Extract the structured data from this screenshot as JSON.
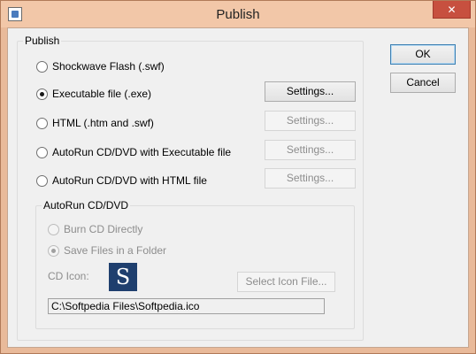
{
  "window": {
    "title": "Publish",
    "close_glyph": "✕",
    "icon": "app-window-icon"
  },
  "publish_group": {
    "legend": "Publish",
    "options": [
      {
        "label": "Shockwave Flash (.swf)",
        "checked": false
      },
      {
        "label": "Executable file (.exe)",
        "checked": true
      },
      {
        "label": "HTML (.htm and .swf)",
        "checked": false
      },
      {
        "label": "AutoRun CD/DVD with Executable file",
        "checked": false
      },
      {
        "label": "AutoRun CD/DVD with HTML file",
        "checked": false
      }
    ],
    "settings_label": "Settings..."
  },
  "autorun_group": {
    "legend": "AutoRun CD/DVD",
    "burn_label": "Burn CD Directly",
    "save_label": "Save Files in a Folder",
    "cd_icon_label": "CD Icon:",
    "icon_letter": "S",
    "select_icon_label": "Select Icon File...",
    "icon_path": "C:\\Softpedia Files\\Softpedia.ico"
  },
  "buttons": {
    "ok": "OK",
    "cancel": "Cancel"
  }
}
